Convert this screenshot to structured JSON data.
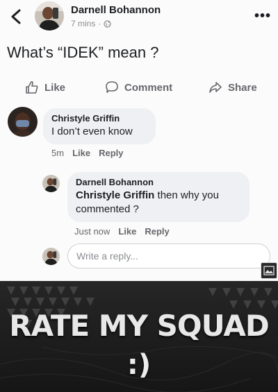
{
  "post": {
    "author": "Darnell Bohannon",
    "time": "7 mins",
    "separator": "·",
    "text": "What’s “IDEK” mean ?"
  },
  "actions": {
    "like": "Like",
    "comment": "Comment",
    "share": "Share"
  },
  "comments": [
    {
      "author": "Christyle Griffin",
      "text": "I don’t even know",
      "time": "5m",
      "like_label": "Like",
      "reply_label": "Reply"
    }
  ],
  "replies": [
    {
      "author": "Darnell Bohannon",
      "mention": "Christyle Griffin",
      "text": " then why you commented ?",
      "time": "Just now",
      "like_label": "Like",
      "reply_label": "Reply"
    }
  ],
  "reply_input": {
    "placeholder": "Write a reply..."
  },
  "banner": {
    "title": "RATE MY SQUAD",
    "smiley": ":)"
  },
  "icons": {
    "back": "chevron-left-icon",
    "privacy": "globe-icon",
    "more": "more-horizontal-icon",
    "like": "thumbs-up-icon",
    "comment": "comment-bubble-icon",
    "share": "share-arrow-icon",
    "image": "image-icon"
  },
  "colors": {
    "text": "#1c1e21",
    "muted": "#65676b",
    "bubble": "#eef0f3",
    "banner_bg": "#1d1d1d"
  }
}
